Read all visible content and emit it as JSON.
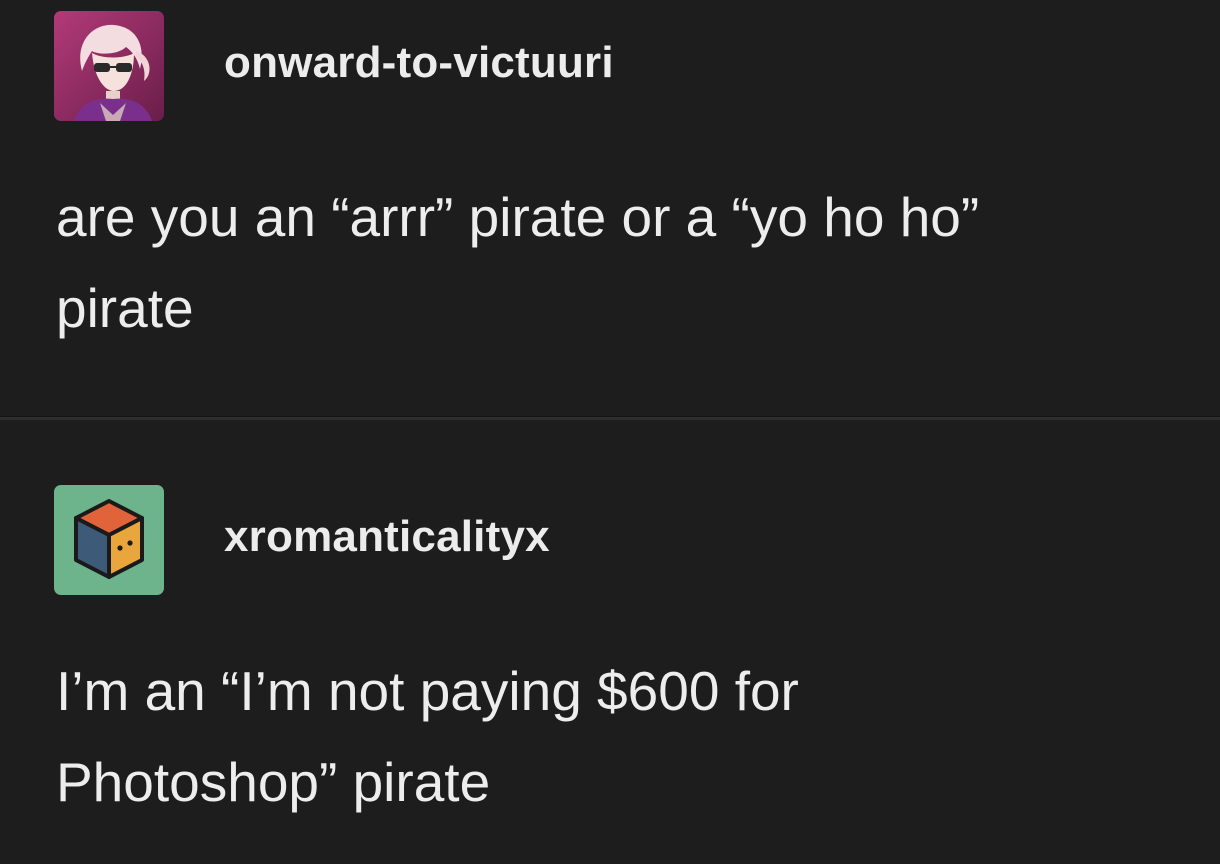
{
  "posts": [
    {
      "username": "onward-to-victuuri",
      "avatar_icon": "anime-character-avatar-icon",
      "avatar_bg": "#8e2a62",
      "lines": [
        "are you an “arrr” pirate or a “yo ho ho”",
        "pirate"
      ]
    },
    {
      "username": "xromanticalityx",
      "avatar_icon": "cube-avatar-icon",
      "avatar_bg": "#6db48c",
      "lines": [
        "I’m an “I’m not paying $600 for",
        "Photoshop” pirate"
      ]
    }
  ],
  "colors": {
    "background": "#1d1d1d",
    "text": "#ededed",
    "divider": "#2e2e2e"
  }
}
